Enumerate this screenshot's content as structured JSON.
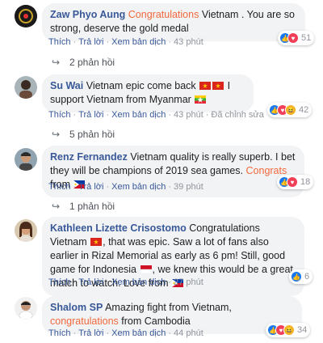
{
  "actions": {
    "like": "Thích",
    "reply": "Trả lời",
    "translate": "Xem bản dịch",
    "sep": "·",
    "edited": "Đã chỉnh sửa"
  },
  "comments": [
    {
      "name": "Zaw Phyo Aung",
      "highlight": "Congratulations",
      "text": "Vietnam . You are so strong, deserve the gold medal",
      "time": "43 phút",
      "reactions": "51",
      "reaction_icons": [
        "like-icon",
        "love-icon"
      ],
      "replies": "2 phản hồi"
    },
    {
      "name": "Su Wai",
      "text_a": "Vietnam epic come back",
      "text_b": "I support Vietnam from Myanmar",
      "time": "43 phút",
      "reactions": "42",
      "reaction_icons": [
        "like-icon",
        "love-icon",
        "haha-icon"
      ],
      "replies": "5 phản hồi"
    },
    {
      "name": "Renz Fernandez",
      "text": "Vietnam quality is really superb. I bet they will be champions of 2019 sea games.",
      "highlight": "Congrats",
      "text_tail": "from",
      "time": "39 phút",
      "reactions": "18",
      "reaction_icons": [
        "like-icon",
        "love-icon"
      ],
      "replies": "1 phản hồi"
    },
    {
      "name": "Kathleen Lizette Crisostomo",
      "text_a": "Congratulations Vietnam",
      "text_b": ", that was epic. Saw a lot of fans also earlier in Rizal Memorial as early as 6 pm! Still, good game for Indonesia",
      "text_c": ", we knew this would be a great match to watch. Love from",
      "time": "27 phút",
      "reactions": "6",
      "reaction_icons": [
        "like-icon"
      ]
    },
    {
      "name": "Shalom SP",
      "text": "Amazing fight from Vietnam,",
      "highlight": "congratulations",
      "text_tail": "from Cambodia",
      "time": "44 phút",
      "reactions": "34",
      "reaction_icons": [
        "like-icon",
        "love-icon",
        "haha-icon"
      ]
    }
  ]
}
